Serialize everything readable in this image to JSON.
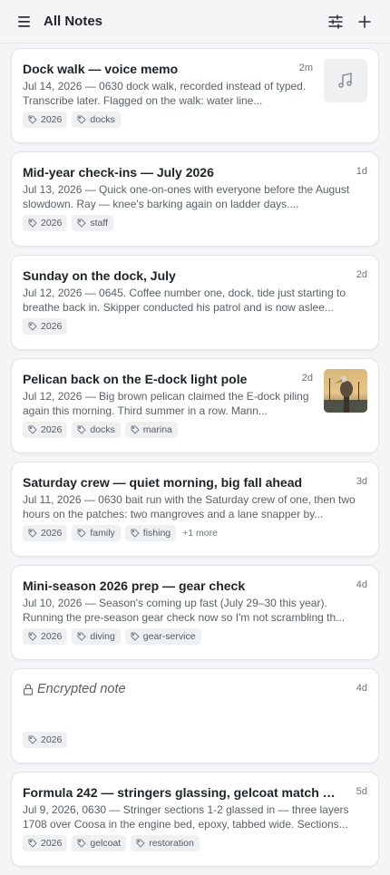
{
  "header": {
    "title": "All Notes",
    "menu_icon": "hamburger-menu-icon",
    "filter_icon": "sliders-icon",
    "add_icon": "plus-icon"
  },
  "colors": {
    "background": "#f4f5f6",
    "card": "#ffffff",
    "tag_bg": "#eef0f2",
    "text_primary": "#1f2328",
    "text_secondary": "#5a6068"
  },
  "notes": [
    {
      "title": "Dock walk — voice memo",
      "time": "2m",
      "snippet": "Jul 14, 2026 — 0630 dock walk, recorded instead of typed. Transcribe later. Flagged on the walk: water line...",
      "tags": [
        "2026",
        "docks"
      ],
      "thumb": "music-note-icon"
    },
    {
      "title": "Mid-year check-ins — July 2026",
      "time": "1d",
      "snippet": "Jul 13, 2026 — Quick one-on-ones with everyone before the August slowdown. Ray — knee's barking again on ladder days....",
      "tags": [
        "2026",
        "staff"
      ]
    },
    {
      "title": "Sunday on the dock, July",
      "time": "2d",
      "snippet": "Jul 12, 2026 — 0645. Coffee number one, dock, tide just starting to breathe back in. Skipper conducted his patrol and is now aslee...",
      "tags": [
        "2026"
      ]
    },
    {
      "title": "Pelican back on the E-dock light pole",
      "time": "2d",
      "snippet": "Jul 12, 2026 — Big brown pelican claimed the E-dock piling again this morning. Third summer in a row. Mann...",
      "tags": [
        "2026",
        "docks",
        "marina"
      ],
      "thumb": "pelican-photo"
    },
    {
      "title": "Saturday crew — quiet morning, big fall ahead",
      "time": "3d",
      "snippet": "Jul 11, 2026 — 0630 bait run with the Saturday crew of one, then two hours on the patches: two mangroves and a lane snapper by...",
      "tags": [
        "2026",
        "family",
        "fishing"
      ],
      "more": "+1 more"
    },
    {
      "title": "Mini-season 2026 prep — gear check",
      "time": "4d",
      "snippet": "Jul 10, 2026 — Season's coming up fast (July 29–30 this year). Running the pre-season gear check now so I'm not scrambling th...",
      "tags": [
        "2026",
        "diving",
        "gear-service"
      ]
    },
    {
      "title": "Encrypted note",
      "time": "4d",
      "snippet": "",
      "tags": [
        "2026"
      ],
      "encrypted": true
    },
    {
      "title": "Formula 242 — stringers glassing, gelcoat match ro...",
      "time": "5d",
      "snippet": "Jul 9, 2026, 0630 — Stringer sections 1-2 glassed in — three layers 1708 over Coosa in the engine bed, epoxy, tabbed wide. Sections...",
      "tags": [
        "2026",
        "gelcoat",
        "restoration"
      ]
    }
  ]
}
